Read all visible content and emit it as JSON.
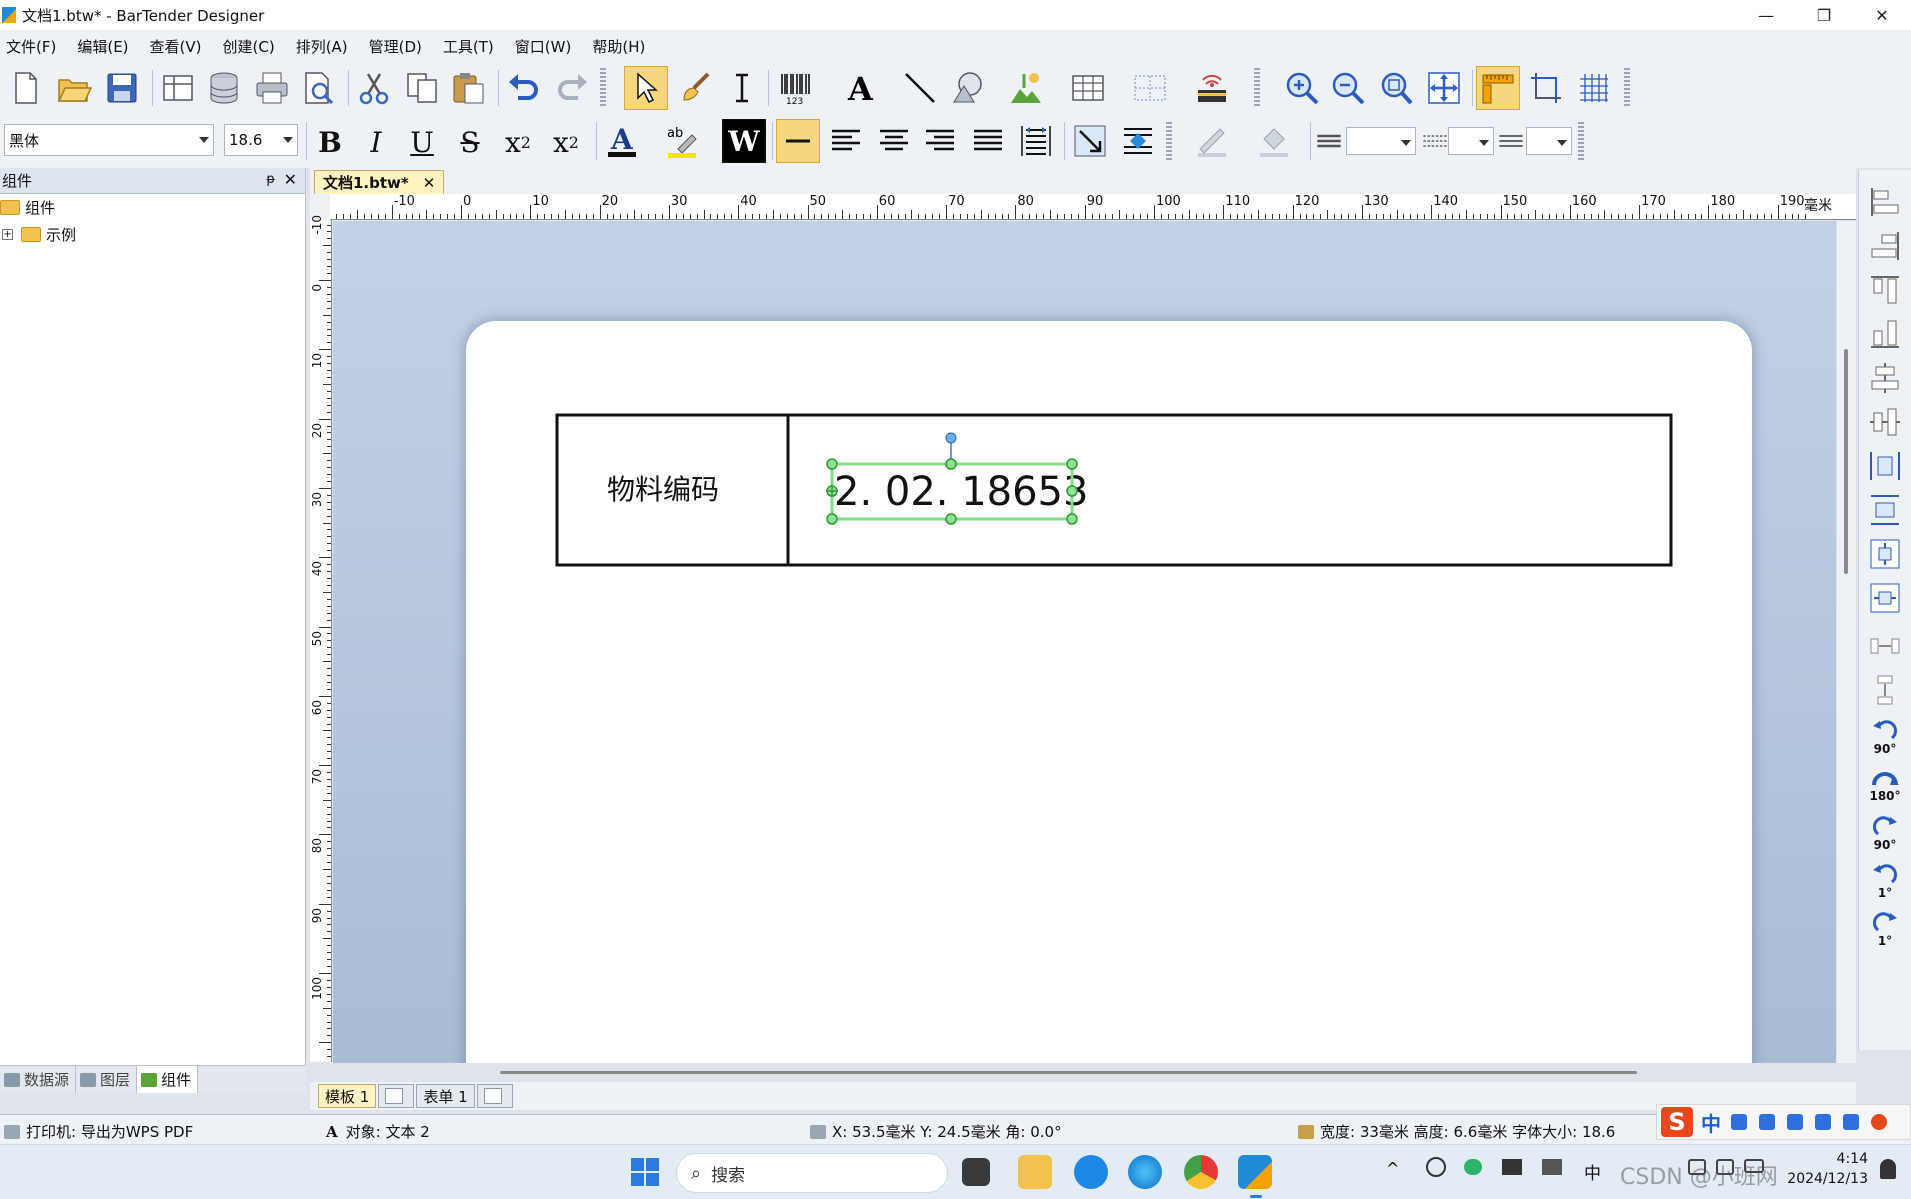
{
  "window": {
    "title": "文档1.btw* - BarTender Designer",
    "controls": [
      "—",
      "❐",
      "✕"
    ]
  },
  "menu": [
    "文件(F)",
    "编辑(E)",
    "查看(V)",
    "创建(C)",
    "排列(A)",
    "管理(D)",
    "工具(T)",
    "窗口(W)",
    "帮助(H)"
  ],
  "format_toolbar": {
    "font": "黑体",
    "size": "18.6",
    "bold": "B",
    "italic": "I",
    "underline": "U",
    "strike": "S",
    "subscript": "x",
    "subscript_mark": "2",
    "superscript": "x",
    "superscript_mark": "2",
    "wrap": "W"
  },
  "left_panel": {
    "title": "组件",
    "pin": "ᵽ",
    "close": "✕",
    "tree": [
      {
        "label": "组件",
        "expander": ""
      },
      {
        "label": "示例",
        "expander": "+"
      }
    ],
    "tabs": [
      "数据源",
      "图层",
      "组件"
    ]
  },
  "document": {
    "tab": "文档1.btw*",
    "tab_close": "✕",
    "ruler_unit": "毫米",
    "ruler_top": [
      "-10",
      "0",
      "10",
      "20",
      "30",
      "40",
      "50",
      "60",
      "70",
      "80",
      "90",
      "100",
      "110",
      "120",
      "130",
      "140",
      "150",
      "160",
      "170",
      "180",
      "190"
    ],
    "ruler_left": [
      "-10",
      "0",
      "10",
      "20",
      "30",
      "40",
      "50",
      "60",
      "70",
      "80",
      "90",
      "100"
    ],
    "cell_label": "物料编码",
    "cell_value": "2. 02. 18653",
    "sheets": [
      "模板 1",
      "表单 1"
    ]
  },
  "right_toolbar": {
    "rotate_ccw_90": "90°",
    "rotate_180": "180°",
    "rotate_cw_90": "90°",
    "rotate_ccw_1": "1°",
    "rotate_cw_1": "1°"
  },
  "status": {
    "printer": "打印机: 导出为WPS PDF",
    "object": "对象: 文本 2",
    "position": "X: 53.5毫米  Y: 24.5毫米  角: 0.0°",
    "size": "宽度: 33毫米  高度: 6.6毫米  字体大小: 18.6"
  },
  "taskbar": {
    "search_placeholder": "搜索",
    "ime_lang": "中",
    "ime_lang_tray": "中",
    "time": "4:14",
    "date": "2024/12/13",
    "watermark": "CSDN @小班网"
  },
  "colors": {
    "accent": "#f7d77e",
    "selection": "#3cb54a",
    "canvas": "#b8c8e0"
  }
}
